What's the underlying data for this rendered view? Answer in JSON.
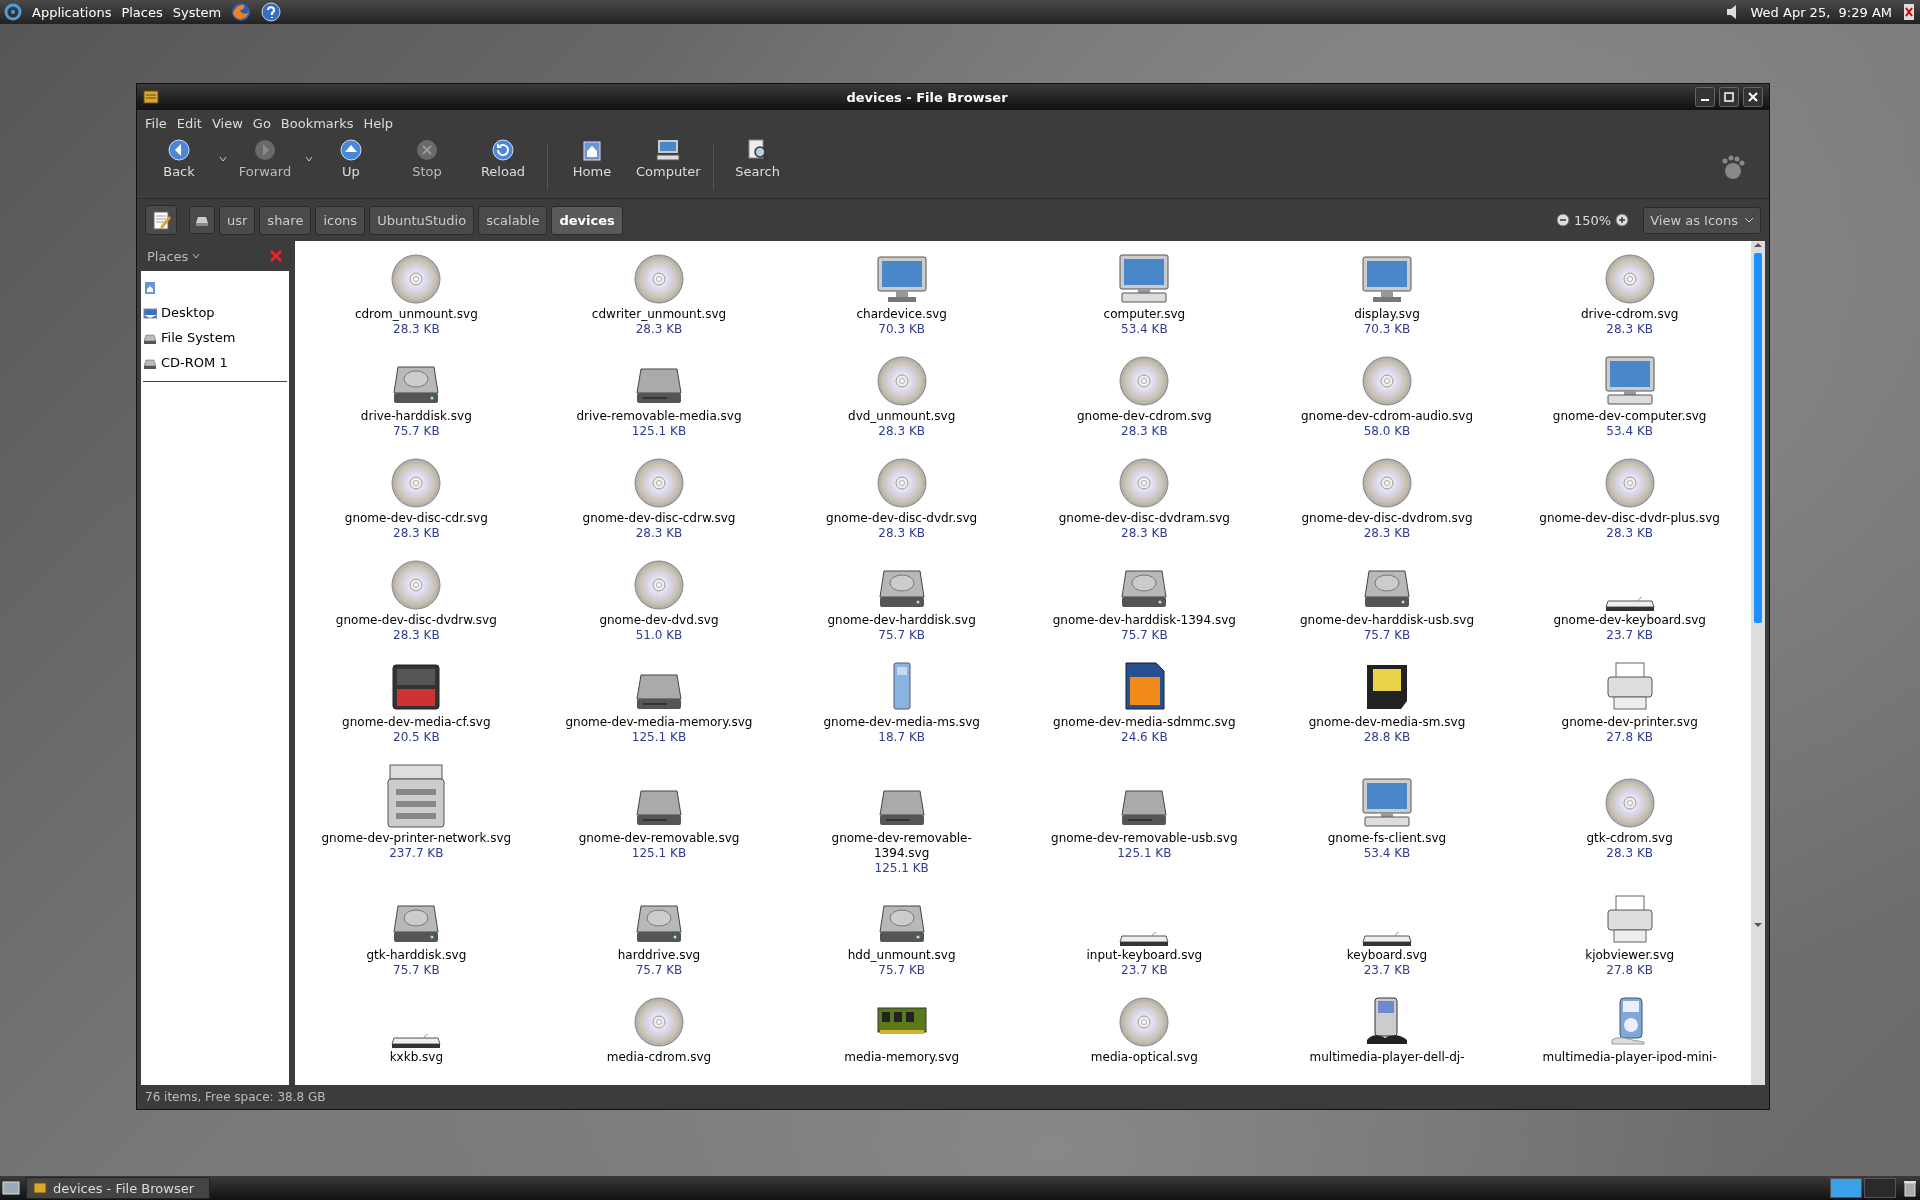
{
  "top_panel": {
    "menus": [
      "Applications",
      "Places",
      "System"
    ],
    "clock": "Wed Apr 25,  9:29 AM"
  },
  "window": {
    "title": "devices - File Browser",
    "menubar": [
      "File",
      "Edit",
      "View",
      "Go",
      "Bookmarks",
      "Help"
    ],
    "toolbar": [
      {
        "label": "Back",
        "disabled": false,
        "dropdown": true
      },
      {
        "label": "Forward",
        "disabled": true,
        "dropdown": true
      },
      {
        "label": "Up",
        "disabled": false,
        "dropdown": false
      },
      {
        "label": "Stop",
        "disabled": true,
        "dropdown": false
      },
      {
        "label": "Reload",
        "disabled": false,
        "dropdown": false
      },
      {
        "label": "Home",
        "disabled": false,
        "dropdown": false
      },
      {
        "label": "Computer",
        "disabled": false,
        "dropdown": false
      },
      {
        "label": "Search",
        "disabled": false,
        "dropdown": false
      }
    ],
    "path": [
      {
        "label": "usr",
        "selected": false
      },
      {
        "label": "share",
        "selected": false
      },
      {
        "label": "icons",
        "selected": false
      },
      {
        "label": "UbuntuStudio",
        "selected": false
      },
      {
        "label": "scalable",
        "selected": false
      },
      {
        "label": "devices",
        "selected": true
      }
    ],
    "zoom": "150%",
    "view_mode": "View as Icons",
    "sidebar": {
      "title": "Places",
      "items": [
        {
          "label": "Desktop"
        },
        {
          "label": "File System"
        },
        {
          "label": "CD-ROM 1"
        }
      ]
    },
    "files": [
      {
        "name": "cdrom_unmount.svg",
        "size": "28.3 KB",
        "kind": "disc"
      },
      {
        "name": "cdwriter_unmount.svg",
        "size": "28.3 KB",
        "kind": "disc"
      },
      {
        "name": "chardevice.svg",
        "size": "70.3 KB",
        "kind": "monitor"
      },
      {
        "name": "computer.svg",
        "size": "53.4 KB",
        "kind": "computer"
      },
      {
        "name": "display.svg",
        "size": "70.3 KB",
        "kind": "monitor"
      },
      {
        "name": "drive-cdrom.svg",
        "size": "28.3 KB",
        "kind": "disc"
      },
      {
        "name": "drive-harddisk.svg",
        "size": "75.7 KB",
        "kind": "harddisk"
      },
      {
        "name": "drive-removable-media.svg",
        "size": "125.1 KB",
        "kind": "removable"
      },
      {
        "name": "dvd_unmount.svg",
        "size": "28.3 KB",
        "kind": "disc"
      },
      {
        "name": "gnome-dev-cdrom.svg",
        "size": "28.3 KB",
        "kind": "disc"
      },
      {
        "name": "gnome-dev-cdrom-audio.svg",
        "size": "58.0 KB",
        "kind": "disc"
      },
      {
        "name": "gnome-dev-computer.svg",
        "size": "53.4 KB",
        "kind": "computer"
      },
      {
        "name": "gnome-dev-disc-cdr.svg",
        "size": "28.3 KB",
        "kind": "disc"
      },
      {
        "name": "gnome-dev-disc-cdrw.svg",
        "size": "28.3 KB",
        "kind": "disc"
      },
      {
        "name": "gnome-dev-disc-dvdr.svg",
        "size": "28.3 KB",
        "kind": "disc"
      },
      {
        "name": "gnome-dev-disc-dvdram.svg",
        "size": "28.3 KB",
        "kind": "disc"
      },
      {
        "name": "gnome-dev-disc-dvdrom.svg",
        "size": "28.3 KB",
        "kind": "disc"
      },
      {
        "name": "gnome-dev-disc-dvdr-plus.svg",
        "size": "28.3 KB",
        "kind": "disc"
      },
      {
        "name": "gnome-dev-disc-dvdrw.svg",
        "size": "28.3 KB",
        "kind": "disc"
      },
      {
        "name": "gnome-dev-dvd.svg",
        "size": "51.0 KB",
        "kind": "disc"
      },
      {
        "name": "gnome-dev-harddisk.svg",
        "size": "75.7 KB",
        "kind": "harddisk"
      },
      {
        "name": "gnome-dev-harddisk-1394.svg",
        "size": "75.7 KB",
        "kind": "harddisk"
      },
      {
        "name": "gnome-dev-harddisk-usb.svg",
        "size": "75.7 KB",
        "kind": "harddisk"
      },
      {
        "name": "gnome-dev-keyboard.svg",
        "size": "23.7 KB",
        "kind": "keyboard"
      },
      {
        "name": "gnome-dev-media-cf.svg",
        "size": "20.5 KB",
        "kind": "cf"
      },
      {
        "name": "gnome-dev-media-memory.svg",
        "size": "125.1 KB",
        "kind": "removable"
      },
      {
        "name": "gnome-dev-media-ms.svg",
        "size": "18.7 KB",
        "kind": "ms"
      },
      {
        "name": "gnome-dev-media-sdmmc.svg",
        "size": "24.6 KB",
        "kind": "sd"
      },
      {
        "name": "gnome-dev-media-sm.svg",
        "size": "28.8 KB",
        "kind": "sm"
      },
      {
        "name": "gnome-dev-printer.svg",
        "size": "27.8 KB",
        "kind": "printer"
      },
      {
        "name": "gnome-dev-printer-network.svg",
        "size": "237.7 KB",
        "kind": "netprinter"
      },
      {
        "name": "gnome-dev-removable.svg",
        "size": "125.1 KB",
        "kind": "removable"
      },
      {
        "name": "gnome-dev-removable-1394.svg",
        "size": "125.1 KB",
        "kind": "removable"
      },
      {
        "name": "gnome-dev-removable-usb.svg",
        "size": "125.1 KB",
        "kind": "removable"
      },
      {
        "name": "gnome-fs-client.svg",
        "size": "53.4 KB",
        "kind": "computer"
      },
      {
        "name": "gtk-cdrom.svg",
        "size": "28.3 KB",
        "kind": "disc"
      },
      {
        "name": "gtk-harddisk.svg",
        "size": "75.7 KB",
        "kind": "harddisk"
      },
      {
        "name": "harddrive.svg",
        "size": "75.7 KB",
        "kind": "harddisk"
      },
      {
        "name": "hdd_unmount.svg",
        "size": "75.7 KB",
        "kind": "harddisk"
      },
      {
        "name": "input-keyboard.svg",
        "size": "23.7 KB",
        "kind": "keyboard"
      },
      {
        "name": "keyboard.svg",
        "size": "23.7 KB",
        "kind": "keyboard"
      },
      {
        "name": "kjobviewer.svg",
        "size": "27.8 KB",
        "kind": "printer"
      },
      {
        "name": "kxkb.svg",
        "kind": "keyboard"
      },
      {
        "name": "media-cdrom.svg",
        "kind": "disc"
      },
      {
        "name": "media-memory.svg",
        "kind": "memory"
      },
      {
        "name": "media-optical.svg",
        "kind": "disc"
      },
      {
        "name": "multimedia-player-dell-dj-",
        "kind": "player"
      },
      {
        "name": "multimedia-player-ipod-mini-",
        "kind": "ipod"
      }
    ],
    "status": "76 items, Free space: 38.8 GB"
  },
  "taskbar": {
    "windows": [
      {
        "label": "devices - File Browser"
      }
    ],
    "workspaces": [
      {
        "selected": true
      },
      {
        "selected": false
      }
    ]
  }
}
